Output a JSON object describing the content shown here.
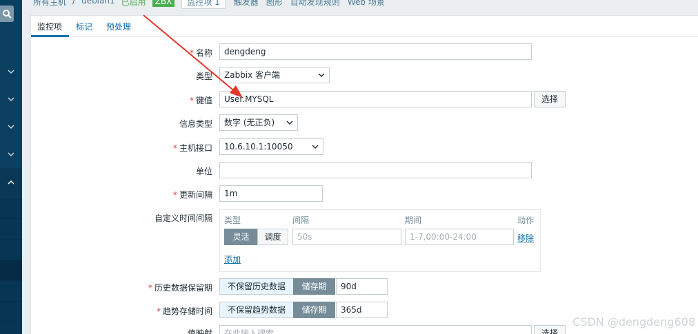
{
  "breadcrumb": {
    "all_hosts": "所有主机",
    "separator": "/",
    "host": "debian1",
    "status": "已启用",
    "zbx_badge": "ZBX",
    "tabs": [
      "监控项 1",
      "触发器",
      "图形",
      "自动发现规则",
      "Web 场景"
    ]
  },
  "sidebar": {
    "search_icon": "search-icon",
    "menu_chevrons": [
      "chevron-down-icon",
      "chevron-down-icon",
      "chevron-down-icon",
      "chevron-down-icon",
      "chevron-up-icon"
    ]
  },
  "subtabs": [
    "监控项",
    "标记",
    "预处理"
  ],
  "form": {
    "name": {
      "label": "名称",
      "value": "dengdeng"
    },
    "type": {
      "label": "类型",
      "value": "Zabbix 客户端"
    },
    "key": {
      "label": "键值",
      "value": "User.MYSQL",
      "button": "选择"
    },
    "info_type": {
      "label": "信息类型",
      "value": "数字 (无正负)"
    },
    "host_interface": {
      "label": "主机接口",
      "value": "10.6.10.1:10050"
    },
    "units": {
      "label": "单位",
      "value": ""
    },
    "update_interval": {
      "label": "更新间隔",
      "value": "1m"
    },
    "custom_intervals": {
      "label": "自定义时间间隔",
      "headers": {
        "type": "类型",
        "interval": "间隔",
        "period": "期间",
        "action": "动作"
      },
      "row": {
        "flexible": "灵活",
        "scheduling": "调度",
        "interval_placeholder": "50s",
        "period_placeholder": "1-7,00:00-24:00",
        "remove": "移除"
      },
      "add": "添加"
    },
    "history": {
      "label": "历史数据保留期",
      "option_off": "不保留历史数据",
      "option_on": "储存期",
      "value": "90d"
    },
    "trends": {
      "label": "趋势存储时间",
      "option_off": "不保留趋势数据",
      "option_on": "储存期",
      "value": "365d"
    },
    "value_map": {
      "label": "值映射",
      "placeholder": "在此输入搜索",
      "button": "选择"
    }
  },
  "watermark": "CSDN @dengdeng608",
  "colors": {
    "sidebar": "#0b3f60",
    "accent": "#0f6ea8",
    "required": "#e33734",
    "annotation_arrow": "#e8352a",
    "zbx_green": "#4caf50"
  }
}
